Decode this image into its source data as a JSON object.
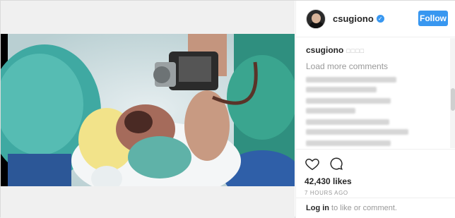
{
  "post": {
    "username": "csugiono",
    "verified_glyph": "✓",
    "follow_label": "Follow",
    "caption_user": "csugiono",
    "caption_text": "□□□□",
    "load_more": "Load more comments",
    "likes": "42,430 likes",
    "time": "7 HOURS AGO",
    "login_link": "Log in",
    "login_rest": " to like or comment."
  },
  "icons": {
    "like": "heart-icon",
    "comment": "comment-icon"
  },
  "colors": {
    "accent": "#3897f0",
    "text": "#262626",
    "muted": "#999999"
  }
}
